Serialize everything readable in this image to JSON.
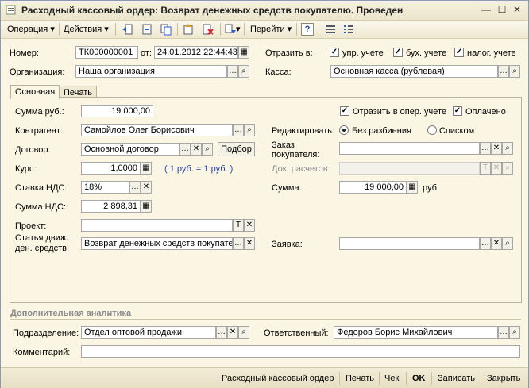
{
  "window": {
    "title": "Расходный кассовый ордер: Возврат денежных средств покупателю. Проведен"
  },
  "toolbar": {
    "operation_label": "Операция",
    "actions_label": "Действия",
    "goto_label": "Перейти"
  },
  "header": {
    "number_label": "Номер:",
    "number_value": "ТК000000001",
    "date_label": "от:",
    "date_value": "24.01.2012 22:44:43",
    "reflect_label": "Отразить в:",
    "mgmt_label": "упр. учете",
    "acct_label": "бух. учете",
    "tax_label": "налог. учете",
    "org_label": "Организация:",
    "org_value": "Наша организация",
    "cash_label": "Касса:",
    "cash_value": "Основная касса (рублевая)"
  },
  "tabs": [
    {
      "label": "Основная"
    },
    {
      "label": "Печать"
    }
  ],
  "main": {
    "sum_label": "Сумма руб.:",
    "sum_value": "19 000,00",
    "reflect_oper_label": "Отразить в опер. учете",
    "paid_label": "Оплачено",
    "counterparty_label": "Контрагент:",
    "counterparty_value": "Самойлов Олег Борисович",
    "edit_label": "Редактировать:",
    "no_split_label": "Без разбиения",
    "list_label": "Списком",
    "contract_label": "Договор:",
    "contract_value": "Основной договор",
    "select_button": "Подбор",
    "order_label": "Заказ покупателя:",
    "rate_label": "Курс:",
    "rate_value": "1,0000",
    "rate_note": "( 1 руб. = 1 руб. )",
    "settle_doc_label": "Док. расчетов:",
    "vat_rate_label": "Ставка НДС:",
    "vat_rate_value": "18%",
    "amount_label": "Сумма:",
    "amount_value": "19 000,00",
    "amount_currency": "руб.",
    "vat_sum_label": "Сумма НДС:",
    "vat_sum_value": "2 898,31",
    "project_label": "Проект:",
    "cashflow_label": "Статья движ. ден. средств:",
    "cashflow_value": "Возврат денежных средств покупате",
    "request_label": "Заявка:"
  },
  "extra": {
    "section_label": "Дополнительная аналитика",
    "division_label": "Подразделение:",
    "division_value": "Отдел оптовой продажи",
    "responsible_label": "Ответственный:",
    "responsible_value": "Федоров Борис Михайлович",
    "comment_label": "Комментарий:"
  },
  "statusbar": {
    "print_form_label": "Расходный кассовый ордер",
    "print_label": "Печать",
    "check_label": "Чек",
    "ok_label": "OK",
    "save_label": "Записать",
    "close_label": "Закрыть"
  },
  "colors": {
    "background": "#fbf6e4",
    "accent_blue": "#2244aa"
  }
}
